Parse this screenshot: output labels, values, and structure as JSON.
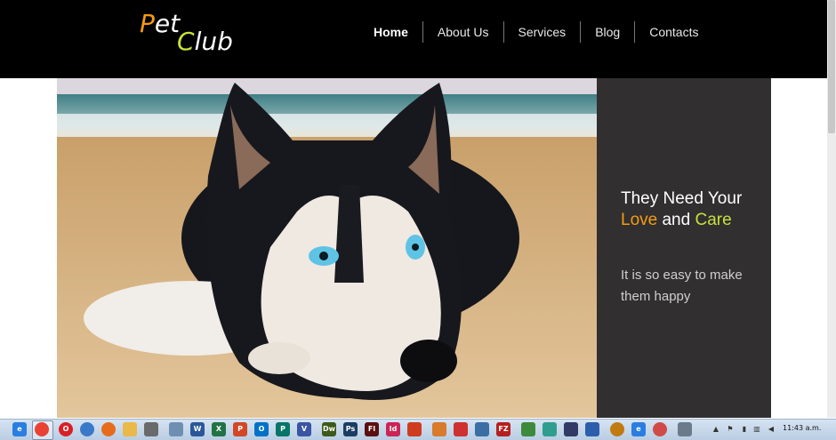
{
  "logo": {
    "part1_initial": "P",
    "part1_rest": "et",
    "part2_initial": "C",
    "part2_rest": "lub"
  },
  "nav": {
    "items": [
      {
        "label": "Home"
      },
      {
        "label": "About Us"
      },
      {
        "label": "Services"
      },
      {
        "label": "Blog"
      },
      {
        "label": "Contacts"
      }
    ]
  },
  "hero": {
    "title_part1": "They Need Your ",
    "title_love": "Love",
    "title_part2": " and ",
    "title_care": "Care",
    "subtitle": "It is so easy to make them happy"
  },
  "colors": {
    "accent_orange": "#f39c12",
    "accent_green": "#c6e13a",
    "panel": "#312f30",
    "header": "#000000"
  },
  "taskbar": {
    "clock": "11:43 a.m."
  }
}
